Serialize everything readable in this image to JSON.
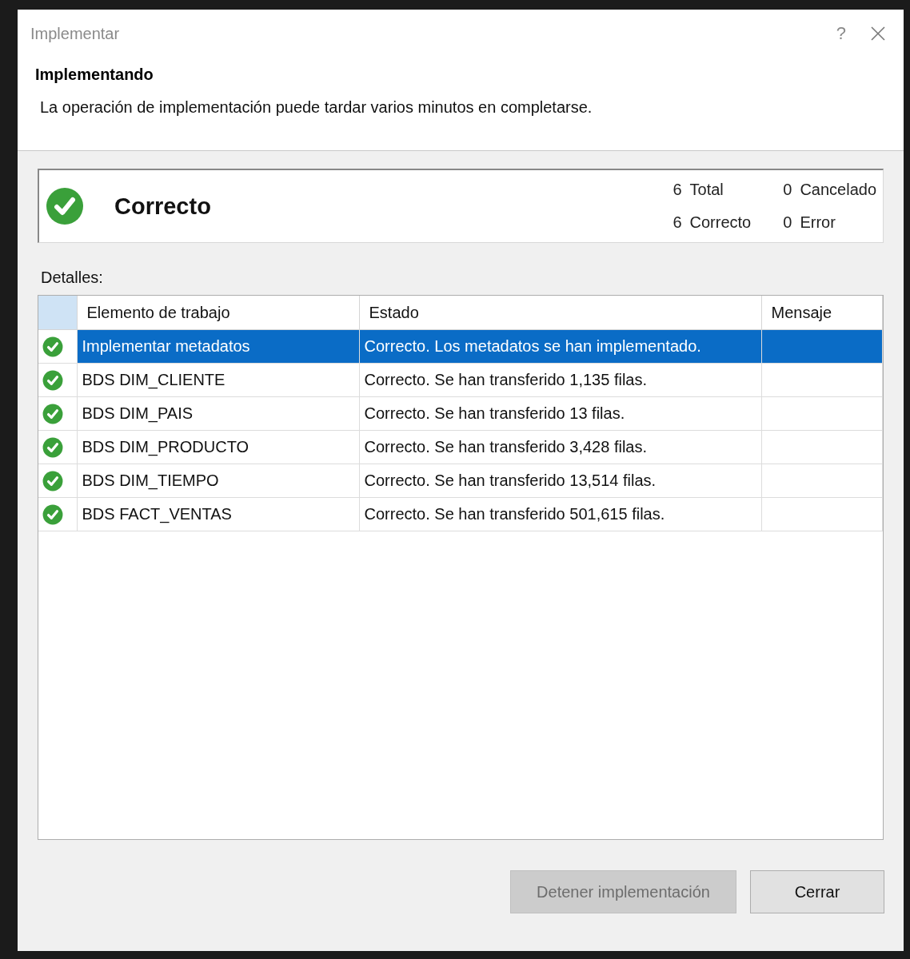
{
  "window": {
    "title": "Implementar",
    "help": "?"
  },
  "header": {
    "title": "Implementando",
    "description": "La operación de implementación puede tardar varios minutos en completarse."
  },
  "summary": {
    "kind": "success",
    "label": "Correcto",
    "counts": [
      {
        "value": "6",
        "label": "Total"
      },
      {
        "value": "0",
        "label": "Cancelado"
      },
      {
        "value": "6",
        "label": "Correcto"
      },
      {
        "value": "0",
        "label": "Error"
      }
    ]
  },
  "details_label": "Detalles:",
  "table": {
    "columns": [
      "Elemento de trabajo",
      "Estado",
      "Mensaje"
    ],
    "rows": [
      {
        "kind": "success",
        "item": "Implementar metadatos",
        "state": "Correcto. Los metadatos se han implementado.",
        "selected": true
      },
      {
        "kind": "success",
        "item": "BDS DIM_CLIENTE",
        "state": "Correcto. Se han transferido 1,135 filas.",
        "selected": false
      },
      {
        "kind": "success",
        "item": "BDS DIM_PAIS",
        "state": "Correcto. Se han transferido 13 filas.",
        "selected": false
      },
      {
        "kind": "success",
        "item": "BDS DIM_PRODUCTO",
        "state": "Correcto. Se han transferido 3,428 filas.",
        "selected": false
      },
      {
        "kind": "success",
        "item": "BDS DIM_TIEMPO",
        "state": "Correcto. Se han transferido 13,514 filas.",
        "selected": false
      },
      {
        "kind": "success",
        "item": "BDS FACT_VENTAS",
        "state": "Correcto. Se han transferido 501,615 filas.",
        "selected": false
      }
    ]
  },
  "buttons": [
    {
      "label": "Detener implementación",
      "disabled": true
    },
    {
      "label": "Cerrar",
      "disabled": false
    }
  ]
}
